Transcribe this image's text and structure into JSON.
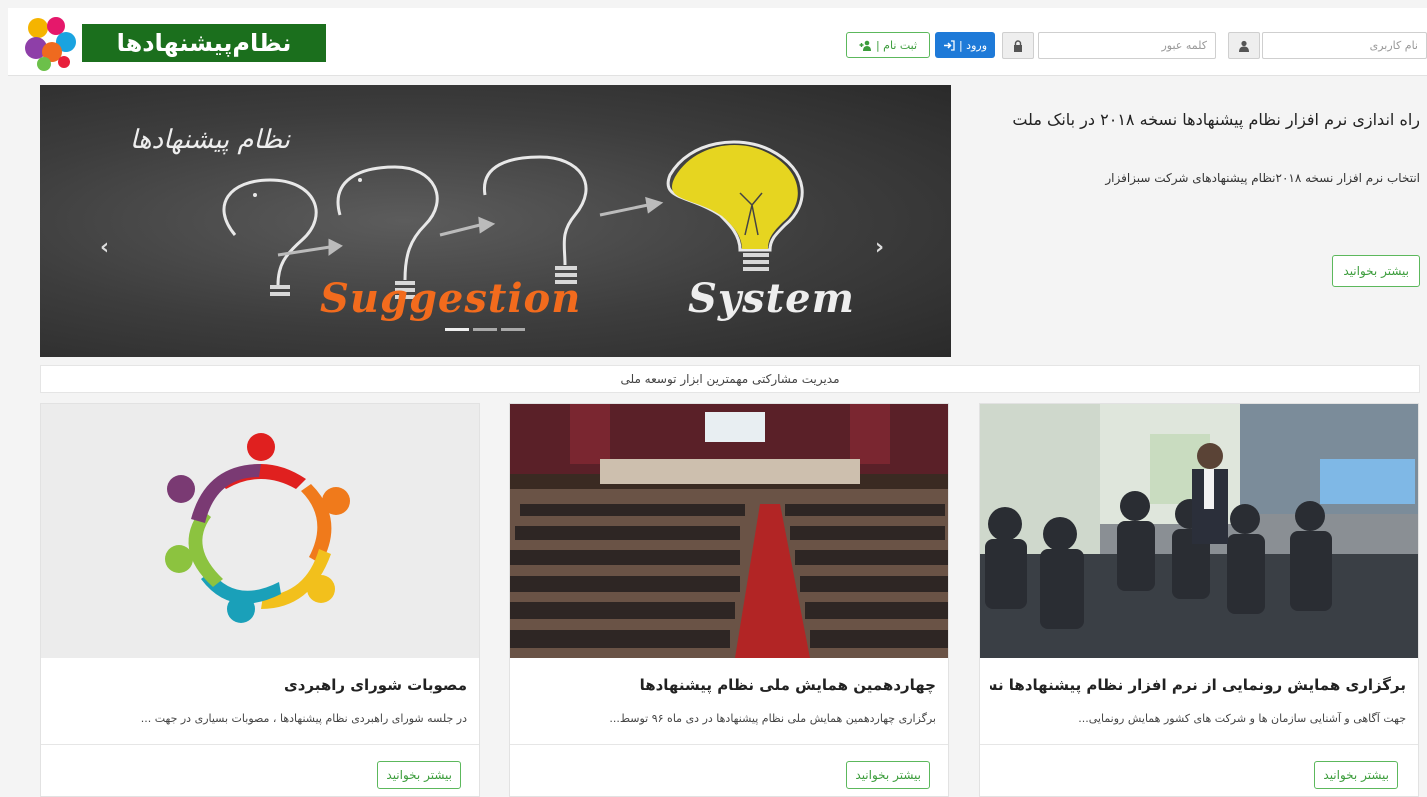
{
  "header": {
    "logo_text": "نظام‌پیشنهادها",
    "username_placeholder": "نام کاربری",
    "password_placeholder": "کلمه عبور",
    "login_label": "ورود |",
    "register_label": "ثبت نام |"
  },
  "carousel": {
    "title": "نظام پیشنهادها",
    "banner_word1": "Suggestion",
    "banner_word2": "System",
    "prev_icon": "chevron-left-icon",
    "next_icon": "chevron-right-icon",
    "slide_count": 3
  },
  "feature": {
    "title": "راه اندازی نرم افزار نظام پیشنهادها نسخه ۲۰۱۸ در بانک ملت",
    "description": "انتخاب نرم افزار نسخه ۲۰۱۸نظام پیشنهادهای شرکت سبزافزار",
    "more_label": "بیشتر بخوانید"
  },
  "slogan": "مدیریت مشارکتی مهمترین ابزار توسعه ملی",
  "cards": [
    {
      "title": "برگزاری همایش رونمایی از نرم افزار نظام پیشنهادها نس ..",
      "description": "جهت آگاهی و آشنایی سازمان ها و شرکت های کشور همایش رونمایی...",
      "more_label": "بیشتر بخوانید"
    },
    {
      "title": "چهاردهمین همایش ملی نظام پیشنهادها",
      "description": "برگزاری چهاردهمین همایش ملی نظام پیشنهادها در دی ماه ۹۶ توسط...",
      "more_label": "بیشتر بخوانید"
    },
    {
      "title": "مصوبات شورای راهبردی",
      "description": "در جلسه شورای راهبردی نظام پیشنهادها ، مصوبات بسیاری در جهت ...",
      "more_label": "بیشتر بخوانید"
    }
  ],
  "colors": {
    "brand_green": "#1b6f1d",
    "login_blue": "#1e7ad8",
    "button_green": "#5cb85c"
  }
}
